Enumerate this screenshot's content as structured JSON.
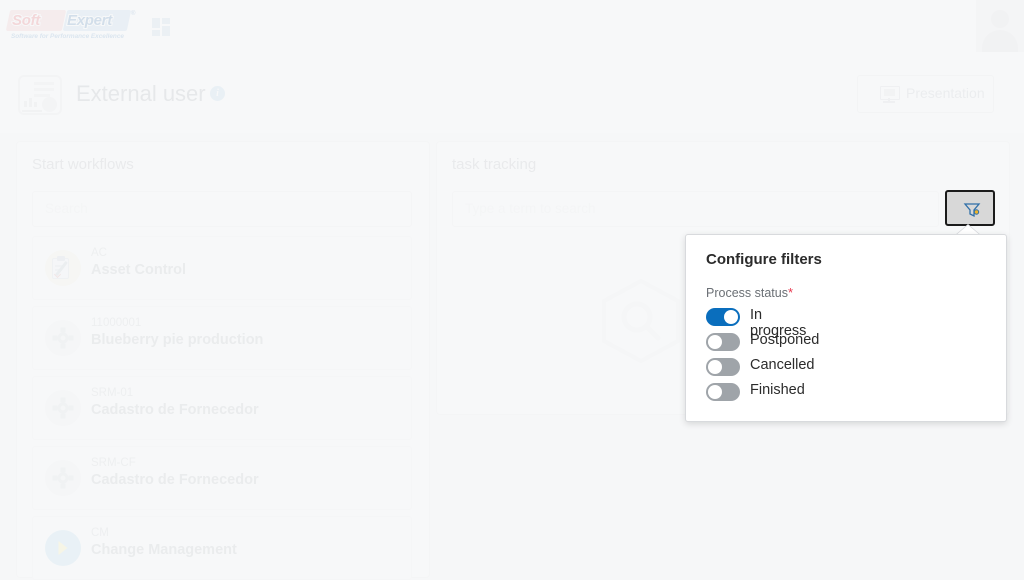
{
  "brand": {
    "logo_soft": "Soft",
    "logo_expert": "Expert",
    "logo_registered": "®",
    "tagline": "Software for Performance Excellence",
    "grid_icon": "apps-grid-icon",
    "avatar_icon": "user-avatar-placeholder"
  },
  "header": {
    "title": "External user",
    "info_icon": "info-icon",
    "info_glyph": "i",
    "page_icon": "dashboard-icon",
    "presentation_button": "Presentation",
    "presentation_icon": "presentation-screen-icon"
  },
  "left_panel": {
    "title": "Start workflows",
    "search_placeholder": "Search",
    "workflows": [
      {
        "code": "AC",
        "name": "Asset Control",
        "icon": "clipboard-pencil-icon",
        "circle_color": "#faf6e0"
      },
      {
        "code": "11000001",
        "name": "Blueberry pie production",
        "icon": "gear-icon",
        "circle_color": "#f0f1f2"
      },
      {
        "code": "SRM-01",
        "name": "Cadastro de Fornecedor",
        "icon": "gear-icon",
        "circle_color": "#f0f1f2"
      },
      {
        "code": "SRM-CF",
        "name": "Cadastro de Fornecedor",
        "icon": "gear-icon",
        "circle_color": "#f0f1f2"
      },
      {
        "code": "CM",
        "name": "Change Management",
        "icon": "arrow-icon",
        "circle_color": "#a9d8f0"
      }
    ]
  },
  "right_panel": {
    "title": "task tracking",
    "search_placeholder": "Type a term to search",
    "filter_button_icon": "funnel-filter-icon",
    "empty_state_icon": "hexagon-magnifier-icon"
  },
  "filter_popup": {
    "title": "Configure filters",
    "field_label": "Process status",
    "required_marker": "*",
    "accent_on_color": "#0a6ebd",
    "accent_off_color": "#9fa4a9",
    "options": [
      {
        "label": "In progress",
        "enabled": true
      },
      {
        "label": "Postponed",
        "enabled": false
      },
      {
        "label": "Cancelled",
        "enabled": false
      },
      {
        "label": "Finished",
        "enabled": false
      }
    ]
  }
}
